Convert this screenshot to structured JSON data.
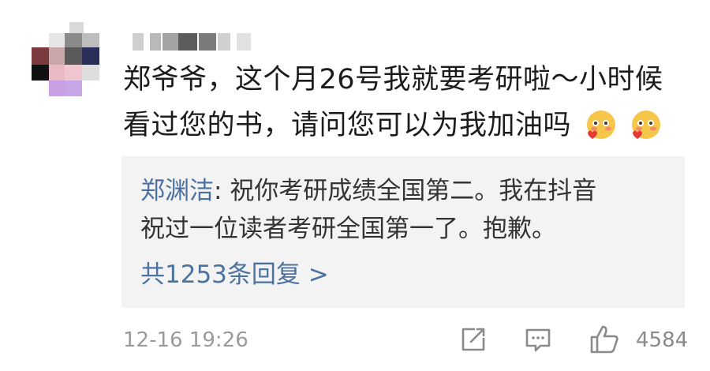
{
  "comment": {
    "text_line1": "郑爷爷，这个月26号我就要考研啦～小时候",
    "text_line2": "看过您的书，请问您可以为我加油吗"
  },
  "reply": {
    "author": "郑渊洁",
    "separator": ": ",
    "text_part1": "祝你考研成绩全国第二。我在抖音",
    "text_line2": "祝过一位读者考研全国第一了。抱歉。",
    "more_label": "共1253条回复 >"
  },
  "footer": {
    "timestamp": "12-16 19:26",
    "like_count": "4584"
  },
  "icons": [
    "share-icon",
    "comment-icon",
    "thumbs-up-icon"
  ],
  "colors": {
    "link": "#4c72a0",
    "reply_bg": "#f3f3f3",
    "meta": "#9b9b9b"
  }
}
